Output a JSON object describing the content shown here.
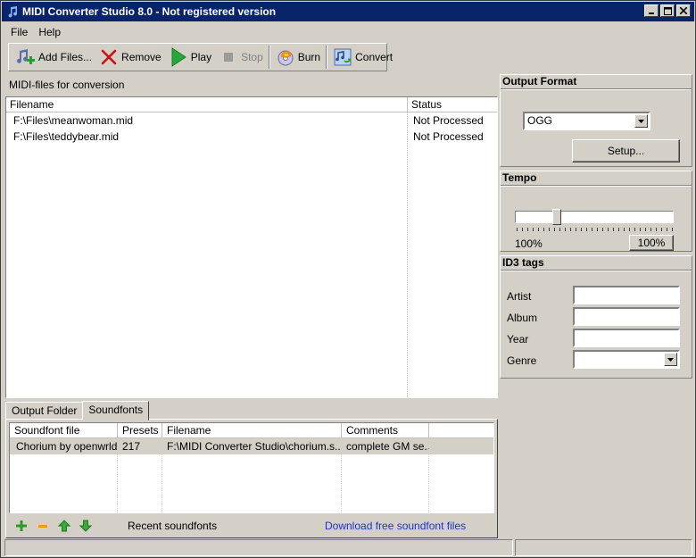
{
  "window": {
    "title": "MIDI Converter Studio 8.0 - Not registered version"
  },
  "menu": {
    "file": "File",
    "help": "Help"
  },
  "toolbar": {
    "add_files": "Add Files...",
    "remove": "Remove",
    "play": "Play",
    "stop": "Stop",
    "burn": "Burn",
    "convert": "Convert"
  },
  "filelist": {
    "label": "MIDI-files for conversion",
    "columns": [
      "Filename",
      "Status"
    ],
    "rows": [
      {
        "filename": "F:\\Files\\meanwoman.mid",
        "status": "Not Processed"
      },
      {
        "filename": "F:\\Files\\teddybear.mid",
        "status": "Not Processed"
      }
    ]
  },
  "tabs": [
    "Output Folder",
    "Soundfonts"
  ],
  "soundfonts": {
    "columns": [
      "Soundfont file",
      "Presets",
      "Filename",
      "Comments"
    ],
    "rows": [
      {
        "file": "Chorium by openwrld",
        "presets": "217",
        "filename": "F:\\MIDI Converter Studio\\chorium.s...",
        "comments": "complete GM se..."
      }
    ],
    "recent": "Recent soundfonts",
    "download": "Download free soundfont files"
  },
  "output_format": {
    "title": "Output Format",
    "selected": "OGG",
    "setup": "Setup..."
  },
  "tempo": {
    "title": "Tempo",
    "value_label": "100%",
    "button": "100%",
    "level_fraction": 0.25
  },
  "id3": {
    "title": "ID3 tags",
    "artist": "Artist",
    "album": "Album",
    "year": "Year",
    "genre": "Genre"
  },
  "colors": {
    "titlebar": "#0a246a",
    "face": "#d4d0c8",
    "link": "#1a33cc"
  }
}
